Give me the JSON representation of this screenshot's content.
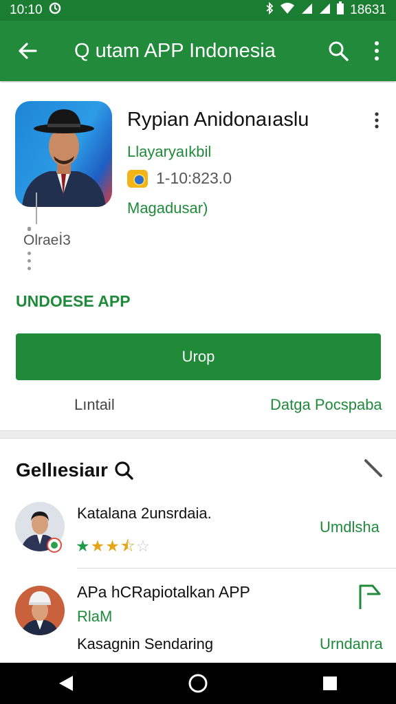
{
  "status_bar": {
    "time": "10:10",
    "right_text": "18631"
  },
  "app_bar": {
    "title": "Q utam APP Indonesia"
  },
  "app": {
    "name": "Rypian Anidonaıaslu",
    "developer": "Llayaryaıkbil",
    "rating_text": "1-10:823.0",
    "category": "Magadusar)",
    "age_label": "Olraeİ3",
    "section_label": "UNDOESE APP",
    "install_label": "Urop",
    "link_left": "Lıntail",
    "link_right": "Datga Pocspaba"
  },
  "section2": {
    "title": "Gellıesiaır",
    "items": [
      {
        "title": "Katalana 2unsrdaia.",
        "rating": 3.5,
        "action": "Umdlsha"
      },
      {
        "title": "APa hCRapiotalkan APP",
        "subtitle": "RlaM",
        "desc": "Kasagnin Sendaring",
        "action": "Urndanra"
      }
    ]
  },
  "colors": {
    "primary": "#228b3b",
    "status_bar": "#1b7d32",
    "accent_text": "#1f8a3a",
    "star_gold": "#e4a517",
    "star_green": "#1f9a4a"
  }
}
